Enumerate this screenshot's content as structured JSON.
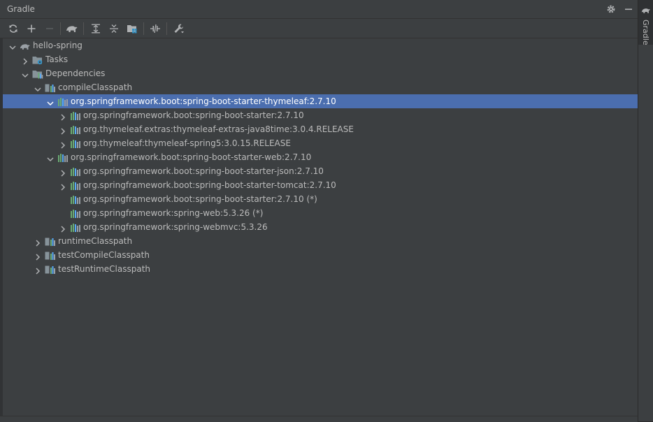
{
  "panel": {
    "title": "Gradle",
    "settings_icon": "gear-icon",
    "minimize_icon": "minimize-icon"
  },
  "toolbar": {
    "buttons": [
      {
        "name": "reload-all-gradle-projects",
        "icon": "refresh-icon"
      },
      {
        "name": "add-gradle-project",
        "icon": "plus-icon"
      },
      {
        "name": "remove-gradle-project",
        "icon": "minus-icon"
      },
      {
        "name": "execute-gradle-task",
        "icon": "elephant-icon"
      },
      {
        "name": "expand-all",
        "icon": "expand-all-icon"
      },
      {
        "name": "collapse-all",
        "icon": "collapse-all-icon"
      },
      {
        "name": "analyze-dependencies",
        "icon": "folder-grid-icon"
      },
      {
        "name": "toggle-offline-mode",
        "icon": "offline-icon"
      },
      {
        "name": "build-tool-settings",
        "icon": "wrench-icon"
      }
    ]
  },
  "tree": [
    {
      "label": "hello-spring",
      "icon": "elephant-icon",
      "depth": 0,
      "expanded": true,
      "has_children": true
    },
    {
      "label": "Tasks",
      "icon": "tasks-folder-icon",
      "depth": 1,
      "expanded": false,
      "has_children": true
    },
    {
      "label": "Dependencies",
      "icon": "dependencies-folder-icon",
      "depth": 1,
      "expanded": true,
      "has_children": true
    },
    {
      "label": "compileClasspath",
      "icon": "configuration-icon",
      "depth": 2,
      "expanded": true,
      "has_children": true
    },
    {
      "label": "org.springframework.boot:spring-boot-starter-thymeleaf:2.7.10",
      "icon": "library-icon",
      "depth": 3,
      "expanded": true,
      "has_children": true,
      "selected": true
    },
    {
      "label": "org.springframework.boot:spring-boot-starter:2.7.10",
      "icon": "library-icon",
      "depth": 4,
      "expanded": false,
      "has_children": true
    },
    {
      "label": "org.thymeleaf.extras:thymeleaf-extras-java8time:3.0.4.RELEASE",
      "icon": "library-icon",
      "depth": 4,
      "expanded": false,
      "has_children": true
    },
    {
      "label": "org.thymeleaf:thymeleaf-spring5:3.0.15.RELEASE",
      "icon": "library-icon",
      "depth": 4,
      "expanded": false,
      "has_children": true
    },
    {
      "label": "org.springframework.boot:spring-boot-starter-web:2.7.10",
      "icon": "library-icon",
      "depth": 3,
      "expanded": true,
      "has_children": true
    },
    {
      "label": "org.springframework.boot:spring-boot-starter-json:2.7.10",
      "icon": "library-icon",
      "depth": 4,
      "expanded": false,
      "has_children": true
    },
    {
      "label": "org.springframework.boot:spring-boot-starter-tomcat:2.7.10",
      "icon": "library-icon",
      "depth": 4,
      "expanded": false,
      "has_children": true
    },
    {
      "label": "org.springframework.boot:spring-boot-starter:2.7.10 (*)",
      "icon": "library-icon",
      "depth": 4,
      "expanded": false,
      "has_children": false
    },
    {
      "label": "org.springframework:spring-web:5.3.26 (*)",
      "icon": "library-icon",
      "depth": 4,
      "expanded": false,
      "has_children": false
    },
    {
      "label": "org.springframework:spring-webmvc:5.3.26",
      "icon": "library-icon",
      "depth": 4,
      "expanded": false,
      "has_children": true
    },
    {
      "label": "runtimeClasspath",
      "icon": "configuration-icon",
      "depth": 2,
      "expanded": false,
      "has_children": true
    },
    {
      "label": "testCompileClasspath",
      "icon": "configuration-icon",
      "depth": 2,
      "expanded": false,
      "has_children": true
    },
    {
      "label": "testRuntimeClasspath",
      "icon": "configuration-icon",
      "depth": 2,
      "expanded": false,
      "has_children": true
    }
  ],
  "side_tab": {
    "label": "Gradle",
    "icon": "elephant-icon"
  },
  "colors": {
    "selection": "#4b6eaf",
    "panel_bg": "#3c3f41",
    "text": "#bbbbbb",
    "bar_green": "#6aab73",
    "bar_blue": "#56a8f5",
    "bar_gray": "#9aa0a6"
  }
}
